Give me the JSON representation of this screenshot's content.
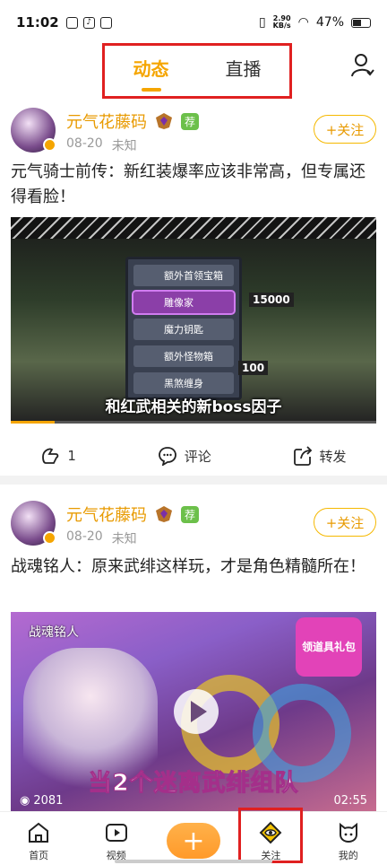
{
  "status_bar": {
    "time": "11:02",
    "net_speed": "2.90",
    "net_speed_unit": "KB/s",
    "battery": "47%"
  },
  "tabs": [
    {
      "label": "动态",
      "active": true
    },
    {
      "label": "直播",
      "active": false
    }
  ],
  "posts": [
    {
      "author": "元气花藤码",
      "badge": "荐",
      "date": "08-20",
      "location": "未知",
      "follow_label": "+关注",
      "text": "元气骑士前传：新红装爆率应该非常高，但专属还得看脸！",
      "media": {
        "caption": "和红武相关的新boss因子",
        "panel_items": [
          "额外首领宝箱",
          "雕像家",
          "魔力钥匙",
          "额外怪物箱",
          "黑煞缠身"
        ],
        "value_a": "15000",
        "value_b": "100",
        "progress": 0.12
      },
      "like_count": "1",
      "comment_label": "评论",
      "share_label": "转发"
    },
    {
      "author": "元气花藤码",
      "badge": "荐",
      "date": "08-20",
      "location": "未知",
      "follow_label": "+关注",
      "text": "战魂铭人：原来武绯这样玩，才是角色精髓所在！",
      "media": {
        "label": "战魂铭人",
        "promo": "领道具礼包",
        "title": "当2个迷离武绯组队",
        "views": "2081",
        "duration": "02:55"
      }
    }
  ],
  "bottom_nav": [
    {
      "label": "首页",
      "icon": "home-icon"
    },
    {
      "label": "视频",
      "icon": "video-icon"
    },
    {
      "label": "",
      "icon": "plus-icon"
    },
    {
      "label": "关注",
      "icon": "follow-diamond-icon"
    },
    {
      "label": "我的",
      "icon": "profile-icon"
    }
  ],
  "colors": {
    "accent": "#f5a500",
    "highlight": "#e02020",
    "recommend": "#6cc04a"
  }
}
